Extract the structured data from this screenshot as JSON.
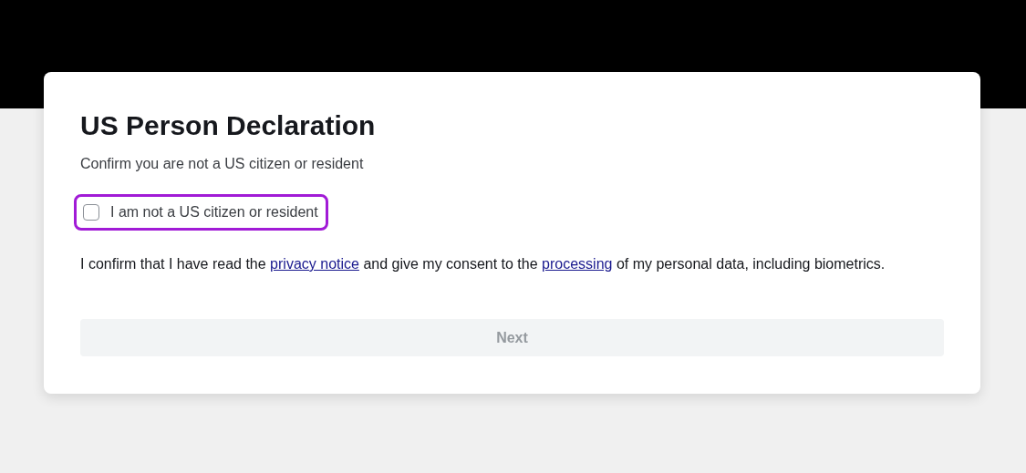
{
  "title": "US Person Declaration",
  "subtitle": "Confirm you are not a US citizen or resident",
  "checkbox": {
    "label": "I am not a US citizen or resident",
    "checked": false,
    "highlighted": true
  },
  "consent": {
    "parts": [
      {
        "kind": "text",
        "text": "I confirm that I have read the "
      },
      {
        "kind": "link",
        "text": "privacy notice"
      },
      {
        "kind": "text",
        "text": " and give my consent to the "
      },
      {
        "kind": "link",
        "text": "processing"
      },
      {
        "kind": "text",
        "text": " of my personal data, including biometrics."
      }
    ]
  },
  "next_button": {
    "label": "Next",
    "disabled": true
  }
}
